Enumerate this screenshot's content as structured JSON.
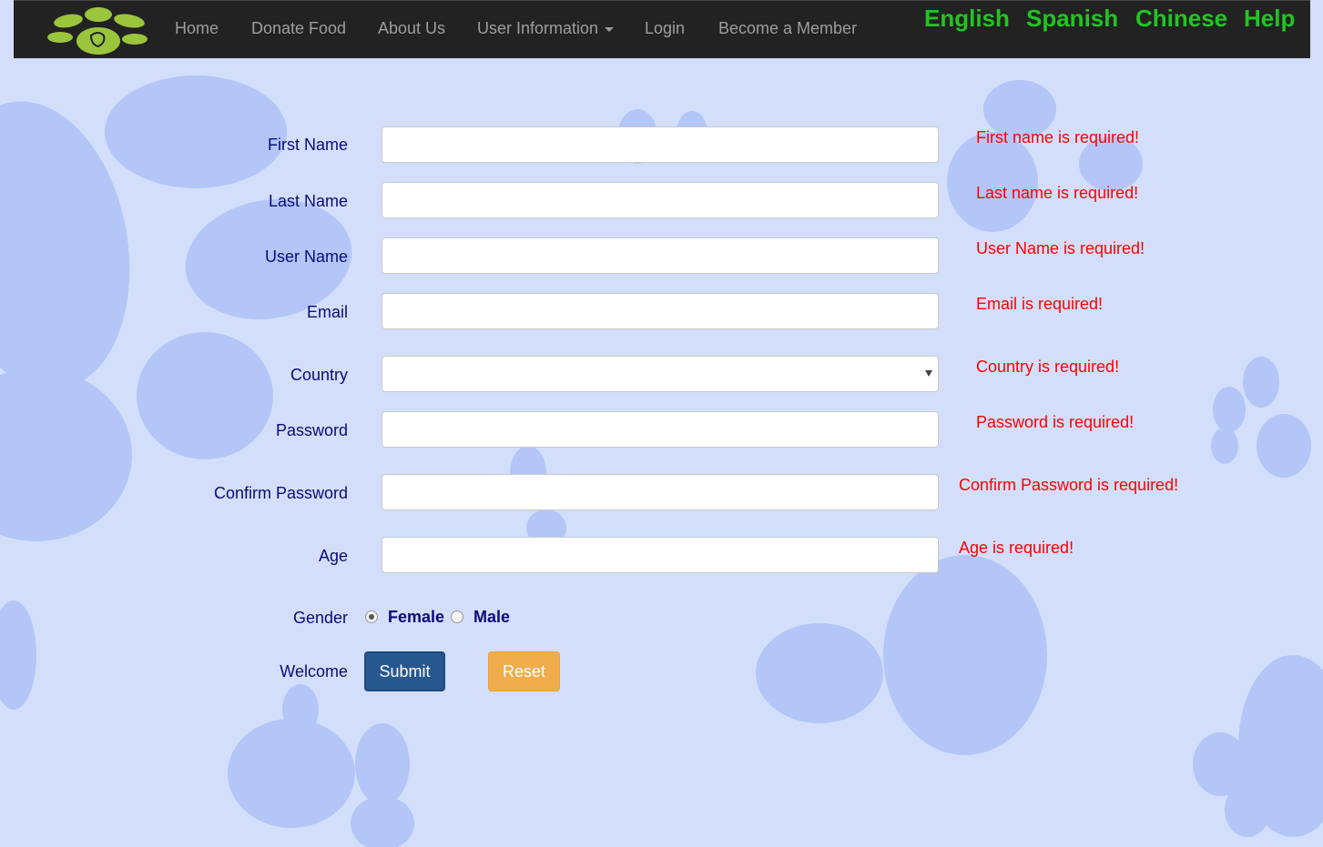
{
  "nav": {
    "items": [
      {
        "label": "Home"
      },
      {
        "label": "Donate Food"
      },
      {
        "label": "About Us"
      },
      {
        "label": "User Information"
      },
      {
        "label": "Login"
      },
      {
        "label": "Become a Member"
      }
    ],
    "languages": [
      "English",
      "Spanish",
      "Chinese"
    ],
    "help": "Help"
  },
  "form": {
    "first_name": {
      "label": "First Name",
      "value": "",
      "error": "First name is required!"
    },
    "last_name": {
      "label": "Last Name",
      "value": "",
      "error": "Last name is required!"
    },
    "user_name": {
      "label": "User Name",
      "value": "",
      "error": "User Name is required!"
    },
    "email": {
      "label": "Email",
      "value": "",
      "error": "Email is required!"
    },
    "country": {
      "label": "Country",
      "value": "",
      "error": "Country is required!"
    },
    "password": {
      "label": "Password",
      "value": "",
      "error": "Password is required!"
    },
    "confirm_password": {
      "label": "Confirm Password",
      "value": "",
      "error": "Confirm Password is required!"
    },
    "age": {
      "label": "Age",
      "value": "",
      "error": "Age is required!"
    },
    "gender": {
      "label": "Gender",
      "options": [
        "Female",
        "Male"
      ],
      "selected": "Female"
    },
    "welcome_label": "Welcome",
    "submit_label": "Submit",
    "reset_label": "Reset"
  },
  "colors": {
    "background": "#d3dffa",
    "paw": "#b3c6f7",
    "navbar": "#222222",
    "lang_links": "#22c422",
    "error": "#ff0000",
    "label": "#0b0b7a",
    "submit": "#27578f",
    "reset": "#f0ad4e"
  },
  "icons": [
    "paw-logo-icon",
    "caret-down-icon",
    "select-arrow-icon"
  ]
}
